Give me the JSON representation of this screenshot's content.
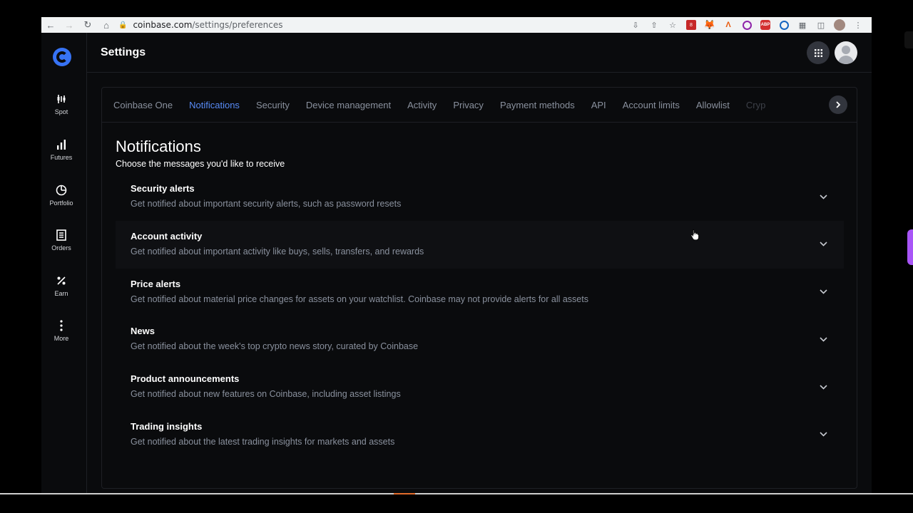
{
  "browser": {
    "url_domain": "coinbase.com",
    "url_path": "/settings/preferences",
    "extension_badge": "8"
  },
  "sidebar": {
    "items": [
      {
        "label": "Spot",
        "icon": "candlestick-icon"
      },
      {
        "label": "Futures",
        "icon": "bar-chart-icon"
      },
      {
        "label": "Portfolio",
        "icon": "pie-chart-icon"
      },
      {
        "label": "Orders",
        "icon": "document-icon"
      },
      {
        "label": "Earn",
        "icon": "percent-icon"
      },
      {
        "label": "More",
        "icon": "more-vertical-icon"
      }
    ]
  },
  "header": {
    "title": "Settings"
  },
  "tabs": [
    {
      "label": "Coinbase One",
      "active": false
    },
    {
      "label": "Notifications",
      "active": true
    },
    {
      "label": "Security",
      "active": false
    },
    {
      "label": "Device management",
      "active": false
    },
    {
      "label": "Activity",
      "active": false
    },
    {
      "label": "Privacy",
      "active": false
    },
    {
      "label": "Payment methods",
      "active": false
    },
    {
      "label": "API",
      "active": false
    },
    {
      "label": "Account limits",
      "active": false
    },
    {
      "label": "Allowlist",
      "active": false
    },
    {
      "label": "Cryp",
      "active": false
    }
  ],
  "notifications": {
    "title": "Notifications",
    "subtitle": "Choose the messages you'd like to receive",
    "items": [
      {
        "title": "Security alerts",
        "description": "Get notified about important security alerts, such as password resets"
      },
      {
        "title": "Account activity",
        "description": "Get notified about important activity like buys, sells, transfers, and rewards"
      },
      {
        "title": "Price alerts",
        "description": "Get notified about material price changes for assets on your watchlist. Coinbase may not provide alerts for all assets"
      },
      {
        "title": "News",
        "description": "Get notified about the week's top crypto news story, curated by Coinbase"
      },
      {
        "title": "Product announcements",
        "description": "Get notified about new features on Coinbase, including asset listings"
      },
      {
        "title": "Trading insights",
        "description": "Get notified about the latest trading insights for markets and assets"
      }
    ]
  },
  "colors": {
    "accent": "#588bf6",
    "brand": "#3773f5",
    "background": "#0a0b0d",
    "muted_text": "#8a919e"
  }
}
